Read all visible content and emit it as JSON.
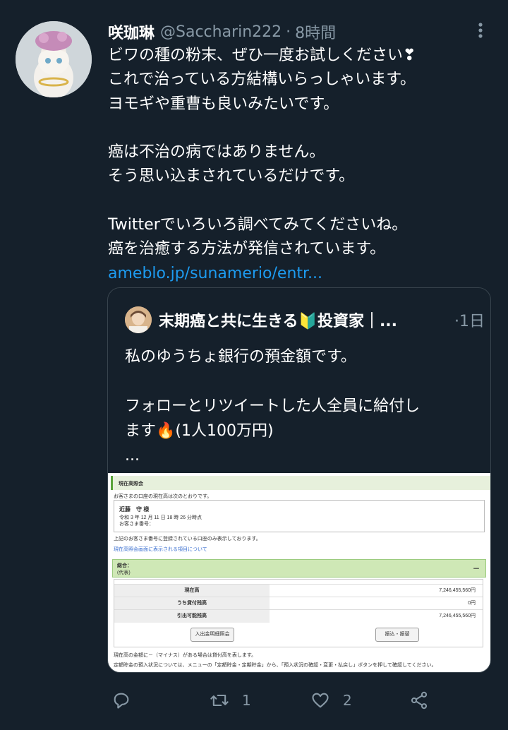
{
  "tweet": {
    "display_name": "咲珈琳",
    "handle": "@Saccharin222",
    "separator": "·",
    "time": "8時間",
    "body_lines": [
      "ビワの種の粉末、ぜひ一度お試しください❣",
      "これで治っている方結構いらっしゃいます。",
      "ヨモギや重曹も良いみたいです。",
      "",
      "癌は不治の病ではありません。",
      "そう思い込まされているだけです。",
      "",
      "Twitterでいろいろ調べてみてくださいね。",
      "癌を治癒する方法が発信されています。"
    ],
    "link_text": "ameblo.jp/sunamerio/entr..."
  },
  "quote": {
    "display_name": "末期癌と共に生きる🔰投資家｜...",
    "separator": "·",
    "time": "1日",
    "body_lines": [
      "私のゆうちょ銀行の預金額です。",
      "",
      "フォローとリツイートした人全員に給付し",
      "ます🔥(1人100万円)",
      "..."
    ],
    "screenshot": {
      "header": "現在高照会",
      "intro": "お客さまの口座の現在高は次のとおりです。",
      "holder": "近藤　守 様",
      "date_line": "令和 3 年 12 月 11 日 18 時 26 分時点",
      "number_label": "お客さま番号：",
      "notice": "上記のお客さま番号に登録されている口座のみ表示しております。",
      "link": "現在高照会画面に表示される項目について",
      "group_label": "総合：",
      "group_sub": "(代表)",
      "minus": "－",
      "rows": [
        {
          "label": "現在高",
          "value": "7,246,455,560円"
        },
        {
          "label": "うち貸付残高",
          "value": "0円"
        },
        {
          "label": "引出可能残高",
          "value": "7,246,455,560円"
        }
      ],
      "button_left": "入出金明細照会",
      "button_right": "振込・振替",
      "note1": "現在高の金額に－（マイナス）がある場合は貸付高を表します。",
      "note2": "定額貯金の預入状況については、メニューの「定額貯金・定期貯金」から、「預入状況の確認・変更・払戻し」ボタンを押して確認してください。"
    }
  },
  "actions": {
    "reply_count": "",
    "retweet_count": "1",
    "like_count": "2"
  },
  "colors": {
    "background": "#15202b",
    "secondary_text": "#8899a6",
    "link": "#1d9bf0",
    "border": "#38444d"
  }
}
